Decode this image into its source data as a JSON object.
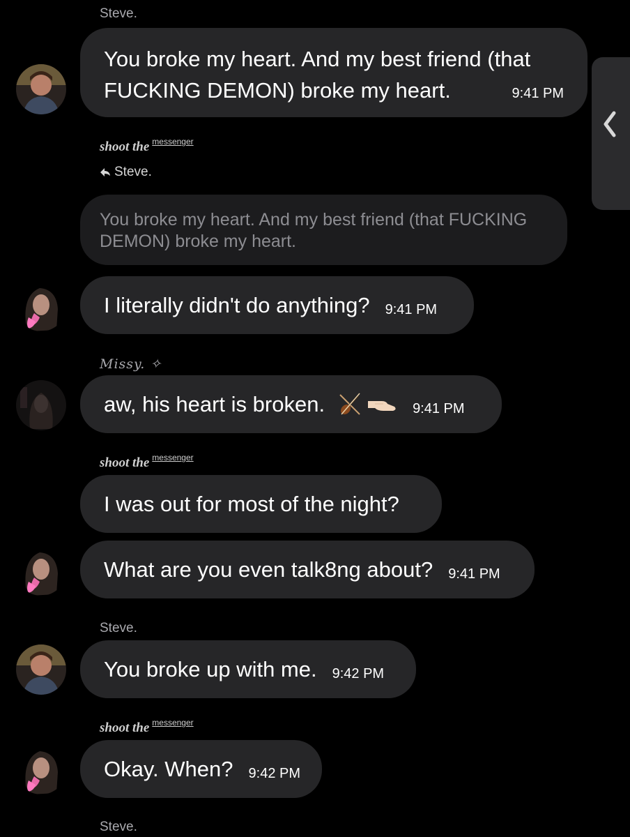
{
  "messages": [
    {
      "sender": "Steve.",
      "text": "You broke my heart. And my best friend (that FUCKING DEMON) broke my heart.",
      "time": "9:41 PM"
    },
    {
      "sender_group": "shoot the",
      "sender_sup": "messenger",
      "reply_to": "Steve.",
      "quoted": "You broke my heart. And my best friend (that FUCKING DEMON) broke my heart.",
      "text": "I literally didn't do anything?",
      "time": "9:41 PM"
    },
    {
      "sender": "Missy. ✧",
      "text": "aw,  his heart is broken.",
      "time": "9:41 PM"
    },
    {
      "sender_group": "shoot the",
      "sender_sup": "messenger",
      "text1": "I was out for most of the night?",
      "text2": "What are you even talk8ng about?",
      "time": "9:41 PM"
    },
    {
      "sender": "Steve.",
      "text": "You broke up with me.",
      "time": "9:42 PM"
    },
    {
      "sender_group": "shoot the",
      "sender_sup": "messenger",
      "text": "Okay. When?",
      "time": "9:42 PM"
    },
    {
      "sender": "Steve."
    }
  ],
  "side_tab": {
    "icon": "chevron-left-icon"
  },
  "emoji": [
    "violin-icon",
    "pointing-hand-icon"
  ],
  "colors": {
    "background": "#000000",
    "bubble": "#262628",
    "quoted_bubble": "#1c1c1e",
    "sender": "#a9a9ae"
  }
}
